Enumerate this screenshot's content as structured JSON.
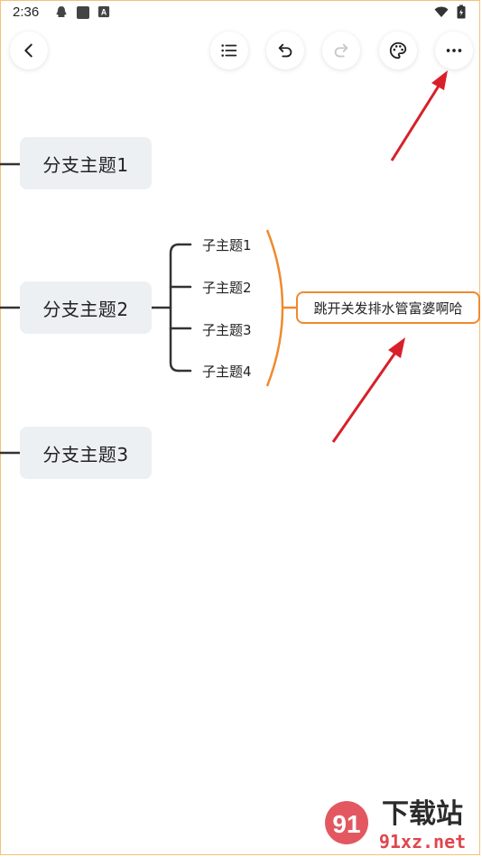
{
  "status_bar": {
    "time": "2:36",
    "left_icons": [
      "qq-icon",
      "square-app-icon",
      "keyboard-a-icon"
    ],
    "right_icons": [
      "wifi-icon",
      "battery-icon"
    ]
  },
  "toolbar": {
    "buttons": [
      "back-icon",
      "outline-list-icon",
      "undo-icon",
      "redo-icon",
      "palette-icon",
      "more-icon"
    ]
  },
  "mind_map": {
    "branches": [
      {
        "label": "分支主题1"
      },
      {
        "label": "分支主题2"
      },
      {
        "label": "分支主题3"
      }
    ],
    "subtopics": [
      "子主题1",
      "子主题2",
      "子主题3",
      "子主题4"
    ],
    "summary": "跳开关发排水管富婆啊哈"
  },
  "colors": {
    "accent_orange": "#f08a2e",
    "arrow_red": "#d8202a",
    "topic_bg": "#edf0f3"
  },
  "watermark": {
    "text": "下载站",
    "domain": "91xz.net",
    "logo_text": "91"
  }
}
